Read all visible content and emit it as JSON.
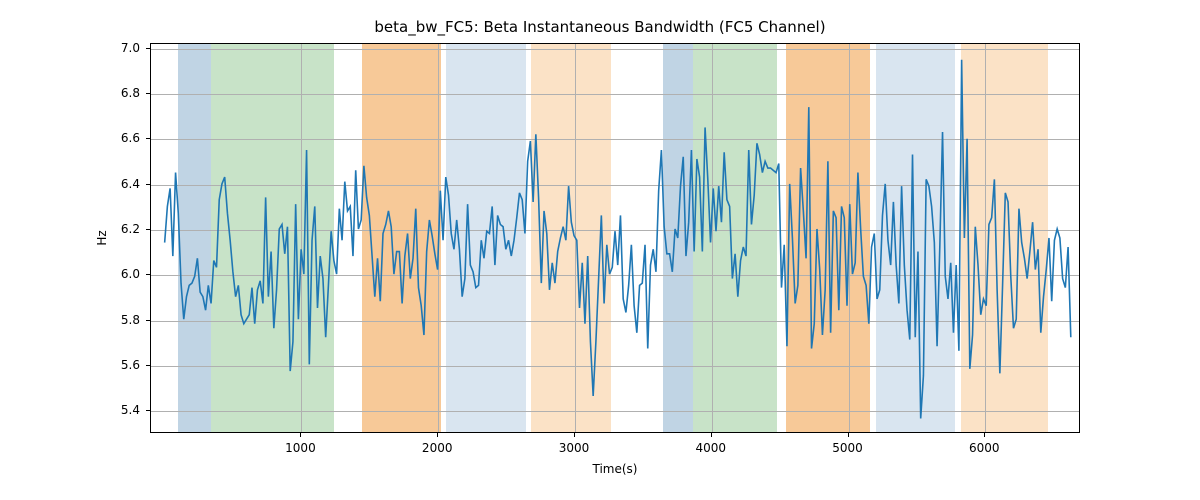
{
  "chart_data": {
    "type": "line",
    "title": "beta_bw_FC5: Beta Instantaneous Bandwidth (FC5 Channel)",
    "xlabel": "Time(s)",
    "ylabel": "Hz",
    "xlim": [
      -100,
      6700
    ],
    "ylim": [
      5.3,
      7.02
    ],
    "xticks": [
      1000,
      2000,
      3000,
      4000,
      5000,
      6000
    ],
    "yticks": [
      5.4,
      5.6,
      5.8,
      6.0,
      6.2,
      6.4,
      6.6,
      6.8,
      7.0
    ],
    "line_color": "#1f77b4",
    "bands": [
      {
        "x0": 100,
        "x1": 340,
        "color": "#c0d4e4"
      },
      {
        "x0": 340,
        "x1": 1240,
        "color": "#c8e3c8"
      },
      {
        "x0": 1440,
        "x1": 2020,
        "color": "#f7c998"
      },
      {
        "x0": 2060,
        "x1": 2640,
        "color": "#d9e5f0"
      },
      {
        "x0": 2680,
        "x1": 3260,
        "color": "#fbe2c6"
      },
      {
        "x0": 3640,
        "x1": 3860,
        "color": "#c0d4e4"
      },
      {
        "x0": 3860,
        "x1": 4480,
        "color": "#c8e3c8"
      },
      {
        "x0": 4540,
        "x1": 5160,
        "color": "#f7c998"
      },
      {
        "x0": 5200,
        "x1": 5780,
        "color": "#d9e5f0"
      },
      {
        "x0": 5820,
        "x1": 6460,
        "color": "#fbe2c6"
      }
    ],
    "series": [
      {
        "name": "beta_bw_FC5",
        "x_start": 0,
        "x_step": 20,
        "y": [
          6.14,
          6.3,
          6.38,
          6.08,
          6.45,
          6.27,
          5.96,
          5.8,
          5.9,
          5.95,
          5.96,
          5.99,
          6.07,
          5.92,
          5.9,
          5.84,
          5.95,
          5.87,
          6.06,
          6.03,
          6.33,
          6.4,
          6.43,
          6.27,
          6.15,
          6.01,
          5.9,
          5.95,
          5.82,
          5.78,
          5.8,
          5.82,
          5.94,
          5.78,
          5.93,
          5.97,
          5.87,
          6.34,
          5.9,
          6.1,
          5.76,
          5.93,
          6.2,
          6.22,
          6.09,
          6.21,
          5.57,
          5.7,
          6.31,
          5.8,
          6.11,
          6.0,
          6.55,
          5.6,
          6.15,
          6.3,
          5.85,
          6.08,
          5.98,
          5.72,
          5.95,
          6.19,
          6.06,
          6.0,
          6.29,
          6.15,
          6.41,
          6.28,
          6.3,
          6.08,
          6.46,
          6.2,
          6.24,
          6.48,
          6.34,
          6.26,
          6.08,
          5.9,
          6.07,
          5.88,
          6.18,
          6.22,
          6.28,
          6.21,
          6.0,
          6.1,
          6.1,
          5.87,
          6.08,
          6.18,
          5.98,
          6.07,
          6.29,
          5.94,
          5.86,
          5.73,
          6.1,
          6.24,
          6.17,
          6.09,
          6.02,
          6.37,
          6.15,
          6.43,
          6.35,
          6.18,
          6.11,
          6.24,
          6.11,
          5.9,
          5.98,
          6.31,
          6.04,
          6.01,
          5.94,
          5.95,
          6.15,
          6.07,
          6.19,
          6.18,
          6.3,
          6.04,
          6.26,
          6.22,
          6.21,
          6.11,
          6.15,
          6.08,
          6.15,
          6.25,
          6.36,
          6.33,
          6.18,
          6.5,
          6.59,
          6.32,
          6.62,
          6.34,
          5.96,
          6.28,
          6.18,
          5.93,
          6.05,
          5.96,
          6.1,
          6.16,
          6.21,
          6.15,
          6.39,
          6.23,
          6.17,
          6.15,
          5.85,
          6.05,
          5.78,
          6.08,
          5.7,
          5.46,
          5.7,
          5.98,
          6.26,
          5.87,
          6.13,
          6.0,
          6.03,
          6.19,
          6.04,
          6.26,
          5.89,
          5.83,
          5.95,
          6.13,
          5.86,
          5.74,
          5.95,
          5.96,
          6.13,
          5.67,
          6.04,
          6.11,
          6.01,
          6.37,
          6.55,
          6.21,
          6.09,
          6.09,
          6.01,
          6.2,
          6.16,
          6.39,
          6.52,
          6.08,
          6.23,
          6.55,
          6.1,
          6.51,
          6.43,
          6.1,
          6.65,
          6.42,
          6.14,
          6.38,
          6.19,
          6.39,
          6.23,
          6.54,
          6.33,
          6.3,
          5.98,
          6.09,
          5.9,
          6.06,
          6.12,
          6.08,
          6.55,
          6.22,
          6.35,
          6.58,
          6.53,
          6.45,
          6.5,
          6.47,
          6.47,
          6.46,
          6.45,
          6.49,
          5.94,
          6.13,
          5.68,
          6.4,
          6.16,
          5.87,
          5.95,
          6.47,
          6.28,
          6.07,
          6.74,
          5.67,
          5.78,
          6.2,
          6.02,
          5.73,
          5.93,
          6.5,
          5.74,
          6.28,
          6.25,
          5.84,
          6.3,
          6.25,
          5.86,
          6.31,
          6.0,
          6.05,
          6.45,
          6.2,
          5.99,
          5.95,
          5.78,
          6.12,
          6.18,
          5.89,
          5.93,
          6.26,
          6.4,
          6.15,
          6.04,
          6.32,
          6.04,
          5.87,
          6.39,
          6.04,
          5.84,
          5.71,
          6.53,
          5.72,
          6.1,
          5.36,
          5.55,
          6.42,
          6.39,
          6.3,
          6.14,
          5.68,
          6.12,
          6.63,
          5.99,
          5.89,
          6.05,
          5.74,
          6.04,
          5.66,
          6.95,
          6.16,
          6.6,
          5.58,
          5.73,
          6.21,
          6.04,
          5.82,
          5.89,
          5.86,
          6.22,
          6.25,
          6.42,
          5.93,
          5.56,
          5.95,
          6.36,
          6.32,
          5.99,
          5.76,
          5.8,
          6.29,
          6.14,
          6.07,
          5.98,
          6.1,
          6.23,
          6.02,
          6.11,
          5.74,
          5.9,
          6.02,
          6.16,
          5.88,
          6.15,
          6.2,
          6.16,
          5.98,
          5.94,
          6.12,
          5.72
        ]
      }
    ]
  }
}
